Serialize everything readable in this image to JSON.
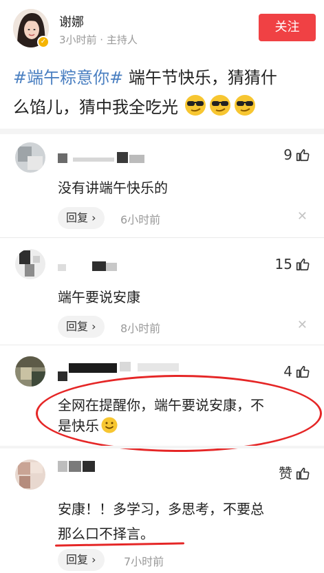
{
  "post": {
    "username": "谢娜",
    "meta": "3小时前 · 主持人",
    "follow_label": "关注",
    "hashtag": "#端午粽意你#",
    "text_line1": " 端午节快乐，猜猜什",
    "text_line2": "么馅儿，猜中我全吃光"
  },
  "comments": [
    {
      "likes": "9",
      "text": "没有讲端午快乐的",
      "reply_label": "回复 ›",
      "time": "6小时前"
    },
    {
      "likes": "15",
      "text": "端午要说安康",
      "reply_label": "回复 ›",
      "time": "8小时前"
    },
    {
      "likes": "4",
      "text_line1": "全网在提醒你，端午要说安康，不",
      "text_line2": "是快乐"
    },
    {
      "likes": "赞",
      "text_line1": "安康！！多学习，多思考，不要总",
      "text_line2": "那么口不择言。",
      "reply_label": "回复 ›",
      "time": "7小时前"
    }
  ],
  "icons": [
    "thumbs-up-icon",
    "close-icon",
    "sunglasses-emoji",
    "smile-emoji",
    "verified-icon"
  ],
  "colors": {
    "follow": "#f04144",
    "hashtag": "#4a7fc1",
    "annotation": "#e52626"
  }
}
